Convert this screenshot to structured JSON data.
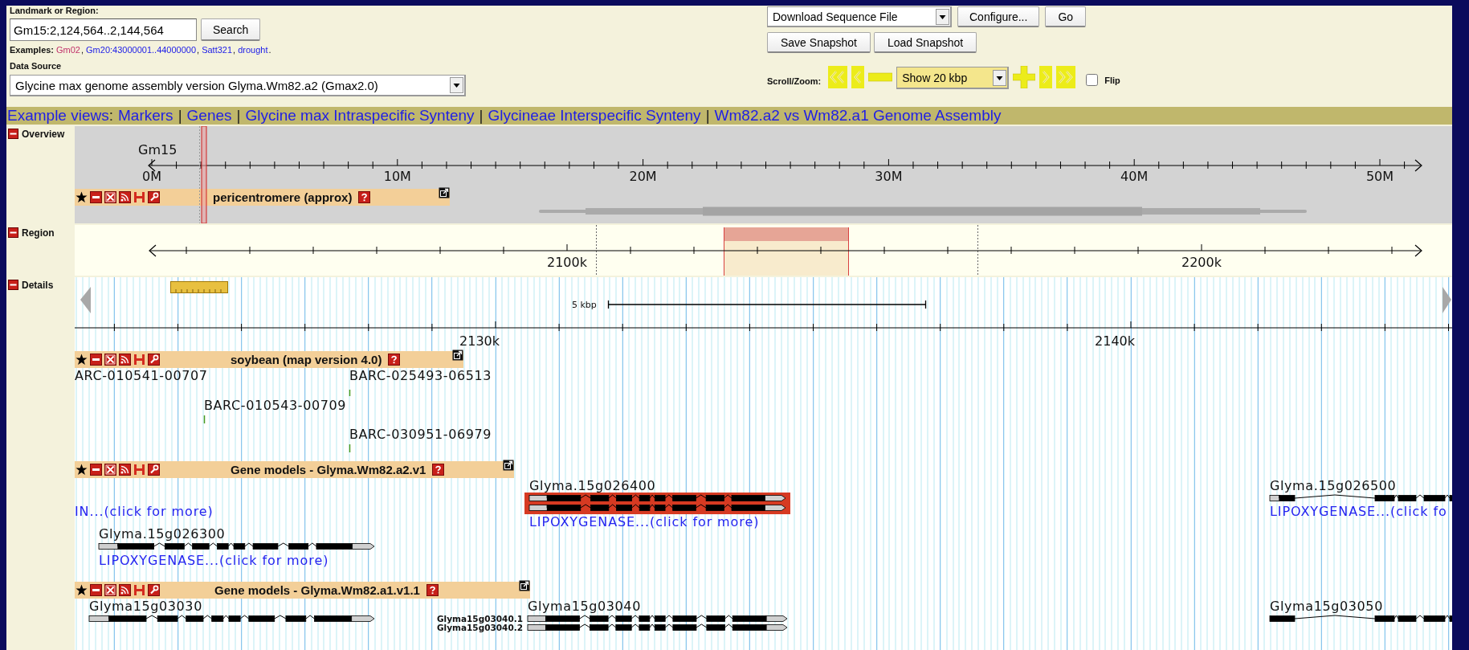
{
  "search": {
    "label": "Landmark or Region:",
    "value": "Gm15:2,124,564..2,144,564",
    "button": "Search"
  },
  "examples": {
    "label": "Examples:",
    "separator": ",",
    "end": ".",
    "items": [
      {
        "text": "Gm02",
        "visited": true
      },
      {
        "text": "Gm20:43000001..44000000",
        "visited": false
      },
      {
        "text": "Satt321",
        "visited": false
      },
      {
        "text": "drought",
        "visited": false
      }
    ]
  },
  "data_source": {
    "label": "Data Source",
    "value": "Glycine max genome assembly version Glyma.Wm82.a2 (Gmax2.0)"
  },
  "download": {
    "value": "Download Sequence File",
    "buttons": [
      "Configure...",
      "Go"
    ]
  },
  "snapshots": [
    "Save Snapshot",
    "Load Snapshot"
  ],
  "scroll_zoom": {
    "label": "Scroll/Zoom:",
    "range": "Show 20 kbp",
    "flip": {
      "label": "Flip",
      "checked": false
    }
  },
  "example_views": {
    "title": "Example views",
    "colon": ":",
    "separator": "|",
    "links": [
      "Markers",
      "Genes",
      "Glycine max Intraspecific Synteny",
      "Glycineae Interspecific Synteny",
      "Wm82.a2 vs Wm82.a1 Genome Assembly"
    ]
  },
  "overview": {
    "title": "Overview",
    "expanded": true,
    "chromosome": "Gm15",
    "ticks": [
      "0M",
      "10M",
      "20M",
      "30M",
      "40M",
      "50M"
    ],
    "track": {
      "title": "pericentromere (approx)"
    }
  },
  "region": {
    "title": "Region",
    "expanded": true,
    "ticks": [
      "2100k",
      "2200k"
    ]
  },
  "details": {
    "title": "Details",
    "expanded": true,
    "scale": "5 kbp",
    "ticks": [
      "2130k",
      "2140k"
    ],
    "tracks": [
      {
        "kind": "markers",
        "title": "soybean (map version 4.0)",
        "features": [
          {
            "label": "ARC-010541-00707"
          },
          {
            "label": "BARC-025493-06513"
          },
          {
            "label": "BARC-010543-00709"
          },
          {
            "label": "BARC-030951-06979"
          }
        ]
      },
      {
        "kind": "genes",
        "title": "Gene models - Glyma.Wm82.a2.v1",
        "features": [
          {
            "description": "IN...(click for more)",
            "highlighted": false
          },
          {
            "name": "Glyma.15g026400",
            "description": "LIPOXYGENASE...(click for more)",
            "highlighted": true
          },
          {
            "name": "Glyma.15g026300",
            "description": "LIPOXYGENASE...(click for more)",
            "highlighted": false
          },
          {
            "name": "Glyma.15g026500",
            "description": "LIPOXYGENASE...(click fo",
            "highlighted": false
          }
        ]
      },
      {
        "kind": "genes",
        "title": "Gene models - Glyma.Wm82.a1.v1.1",
        "features": [
          {
            "name": "Glyma15g03030",
            "highlighted": false
          },
          {
            "name": "Glyma15g03040",
            "transcripts": [
              "Glyma15g03040.1",
              "Glyma15g03040.2"
            ],
            "highlighted": false
          },
          {
            "name": "Glyma15g03050",
            "highlighted": false
          }
        ]
      }
    ]
  }
}
